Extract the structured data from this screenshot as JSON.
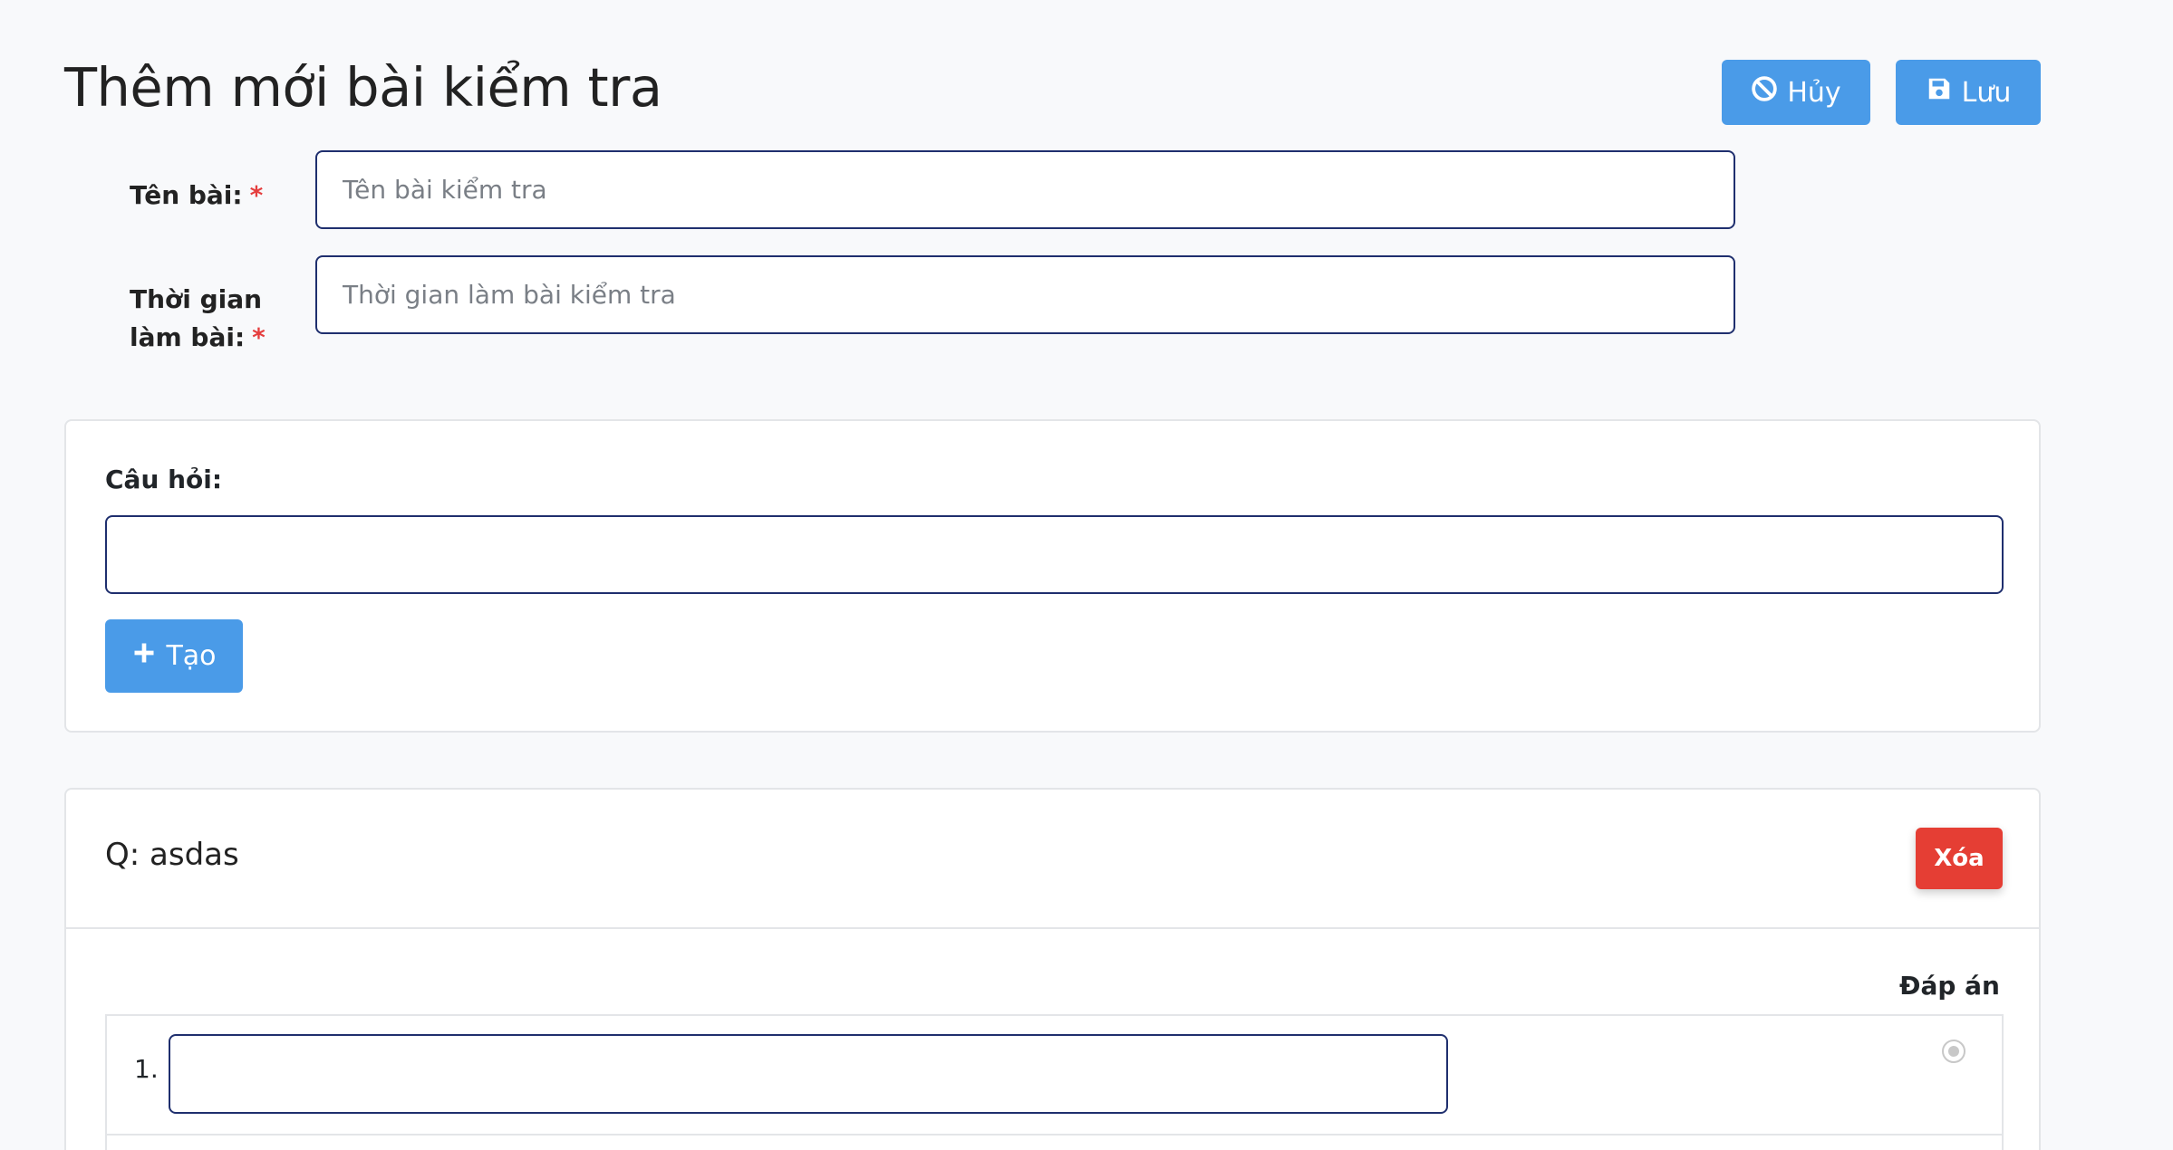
{
  "page": {
    "title": "Thêm mới bài kiểm tra"
  },
  "actions": {
    "cancel_label": "Hủy",
    "save_label": "Lưu"
  },
  "form": {
    "name_label": "Tên bài:",
    "name_placeholder": "Tên bài kiểm tra",
    "time_label_line1": "Thời gian",
    "time_label_line2": "làm bài:",
    "time_placeholder": "Thời gian làm bài kiểm tra",
    "required_mark": "*"
  },
  "question_creator": {
    "label": "Câu hỏi:",
    "value": "",
    "create_label": "Tạo"
  },
  "questions": [
    {
      "title": "Q: asdas",
      "delete_label": "Xóa",
      "answer_header": "Đáp án",
      "answers": [
        {
          "number": "1.",
          "value": ""
        }
      ]
    }
  ],
  "colors": {
    "primary": "#4a9be8",
    "danger": "#e53e34",
    "input_border": "#1f2f6e",
    "required": "#e53e3e"
  }
}
